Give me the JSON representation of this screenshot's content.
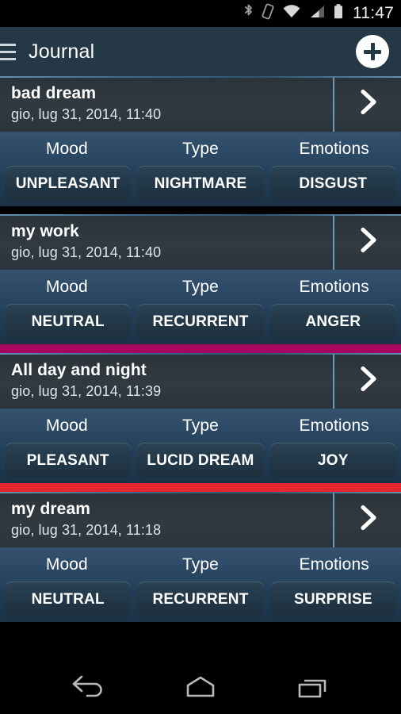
{
  "status_bar": {
    "time": "11:47",
    "icons": [
      "bluetooth-icon",
      "vibrate-icon",
      "wifi-icon",
      "cellular-signal-icon",
      "battery-icon"
    ]
  },
  "action_bar": {
    "menu_icon": "hamburger-menu-icon",
    "title": "Journal",
    "add_icon": "add-plus-icon"
  },
  "column_labels": {
    "mood": "Mood",
    "type": "Type",
    "emotions": "Emotions"
  },
  "colors": {
    "action_bar": "#243845",
    "card_head": "#2f373e",
    "card_body": "#28455f",
    "chip": "#223747",
    "divider_magenta": "#A80561",
    "divider_red": "#E5262F",
    "accent_line": "#7fb1d6",
    "text_primary": "#ffffff"
  },
  "entries": [
    {
      "title": "bad dream",
      "date": "gio, lug 31, 2014, 11:40",
      "mood": "UNPLEASANT",
      "type": "NIGHTMARE",
      "emotion": "DISGUST",
      "chevron": "chevron-right-icon",
      "divider_after": null
    },
    {
      "title": "my work",
      "date": "gio, lug 31, 2014, 11:40",
      "mood": "NEUTRAL",
      "type": "RECURRENT",
      "emotion": "ANGER",
      "chevron": "chevron-right-icon",
      "divider_after": "#A80561"
    },
    {
      "title": "All day and night",
      "date": "gio, lug 31, 2014, 11:39",
      "mood": "PLEASANT",
      "type": "LUCID DREAM",
      "emotion": "JOY",
      "chevron": "chevron-right-icon",
      "divider_after": "#E5262F"
    },
    {
      "title": "my dream",
      "date": "gio, lug 31, 2014, 11:18",
      "mood": "NEUTRAL",
      "type": "RECURRENT",
      "emotion": "SURPRISE",
      "chevron": "chevron-right-icon",
      "divider_after": null
    }
  ],
  "nav_bar": {
    "back": "back-arrow-icon",
    "home": "home-icon",
    "recents": "recent-apps-icon"
  }
}
